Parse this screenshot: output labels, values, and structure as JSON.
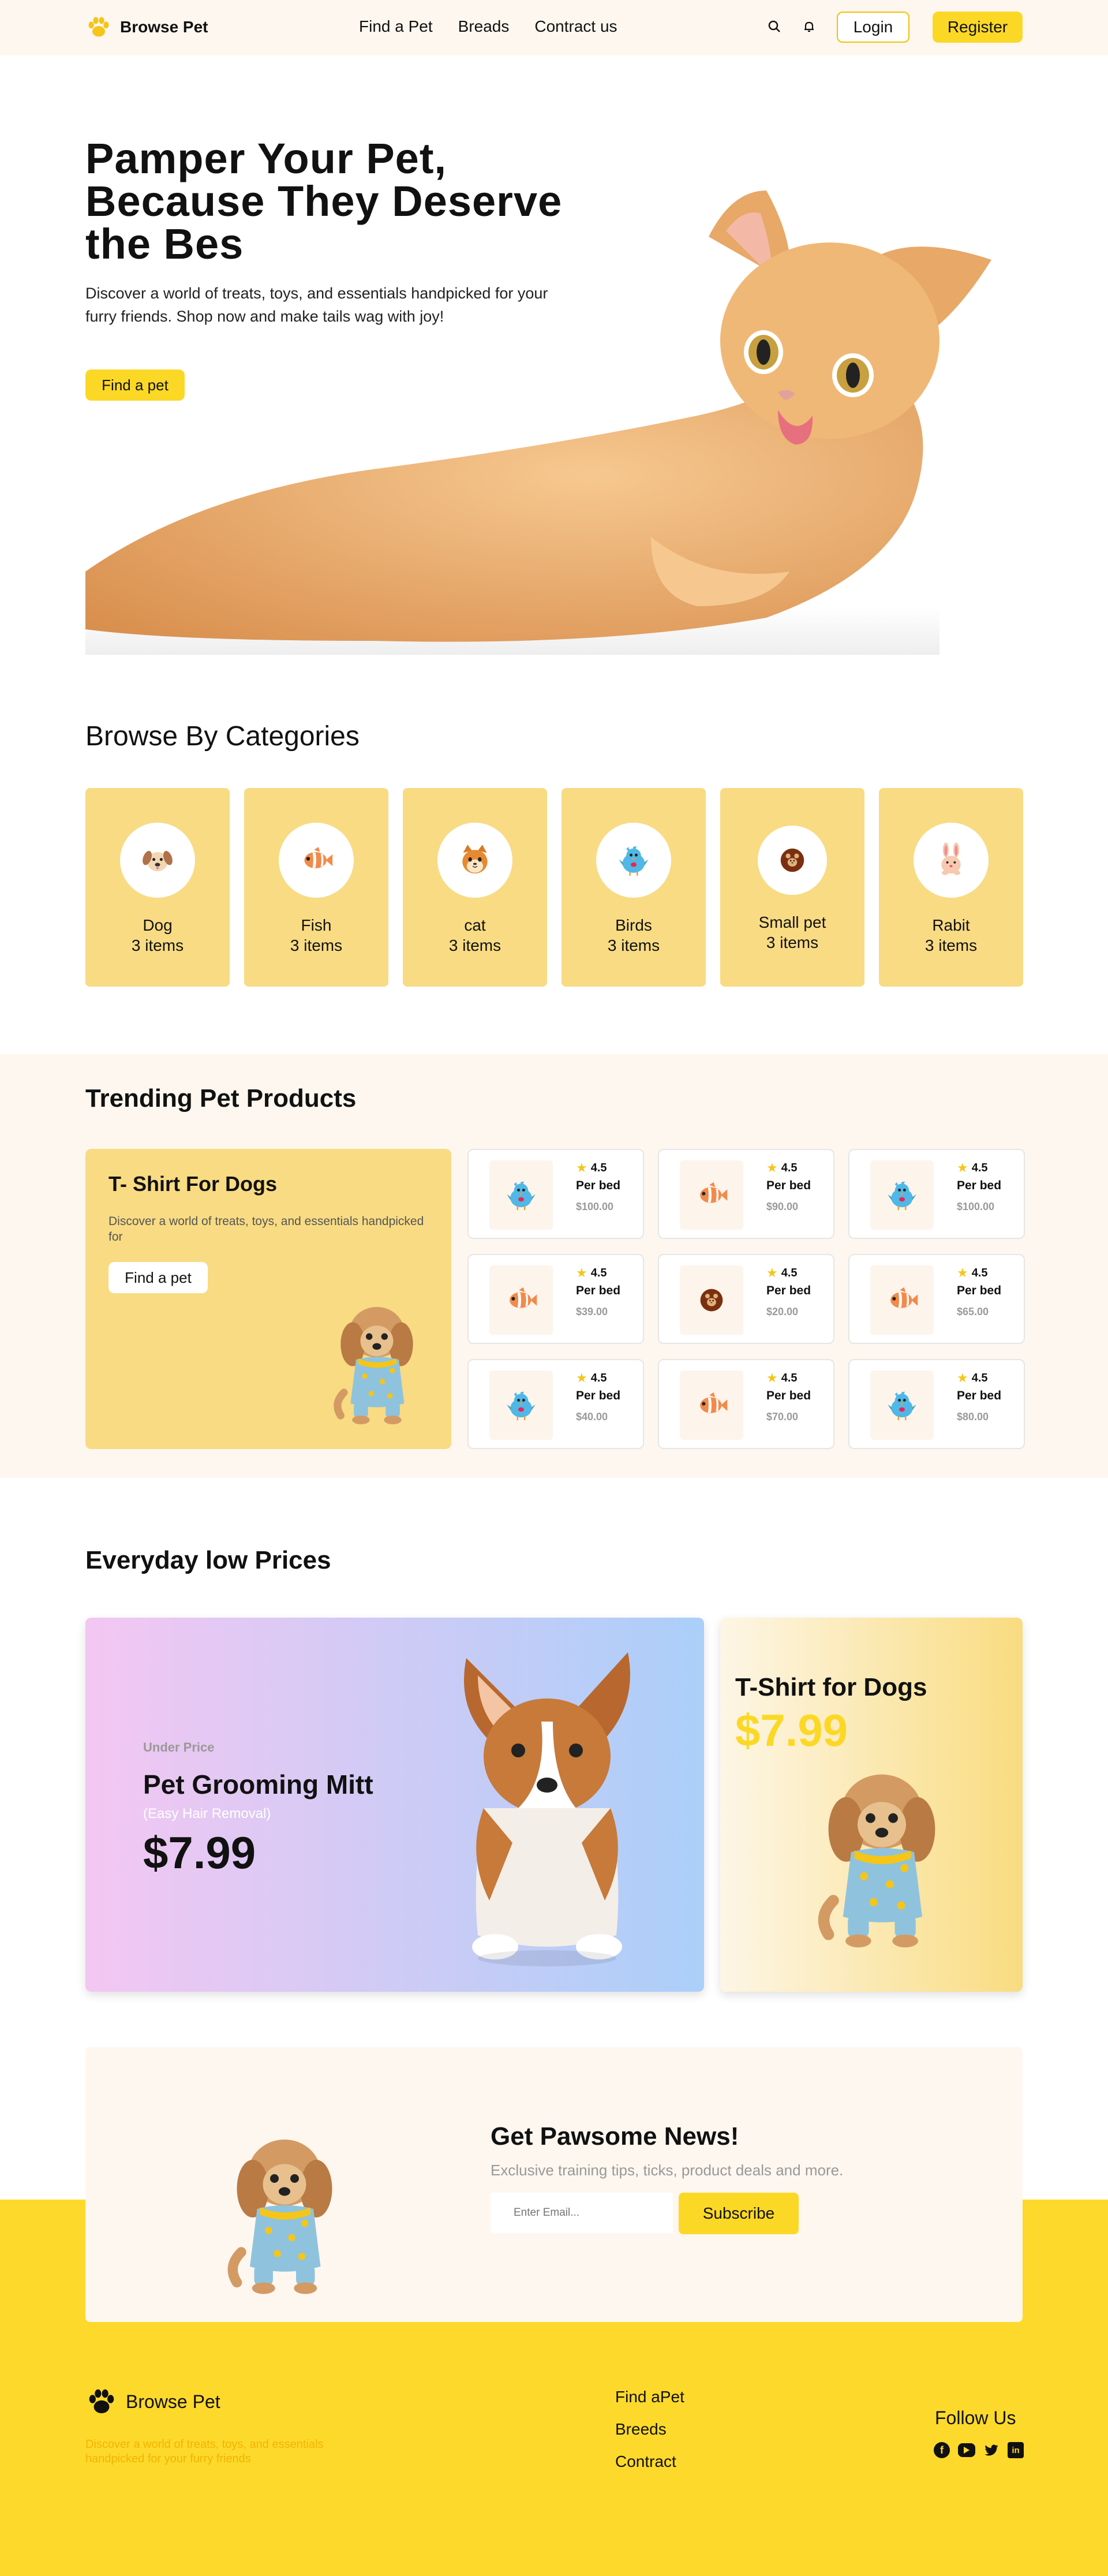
{
  "header": {
    "brand": "Browse Pet",
    "nav": [
      "Find a Pet",
      "Breads",
      "Contract us"
    ],
    "login": "Login",
    "register": "Register"
  },
  "hero": {
    "title_line1": "Pamper Your Pet,",
    "title_line2": "Because They Deserve",
    "title_line3": "the Bes",
    "description": "Discover a world of treats, toys, and essentials handpicked for your furry friends. Shop now and make tails wag with joy!",
    "cta": "Find a pet"
  },
  "categories": {
    "title": "Browse By Categories",
    "items": [
      {
        "name": "Dog",
        "count": "3 items",
        "icon": "dog-face-icon"
      },
      {
        "name": "Fish",
        "count": "3 items",
        "icon": "clownfish-icon"
      },
      {
        "name": "cat",
        "count": "3 items",
        "icon": "cat-face-icon"
      },
      {
        "name": "Birds",
        "count": "3 items",
        "icon": "bird-icon"
      },
      {
        "name": "Small pet",
        "count": "3 items",
        "icon": "hamster-icon"
      },
      {
        "name": "Rabit",
        "count": "3 items",
        "icon": "rabbit-icon"
      }
    ]
  },
  "trending": {
    "title": "Trending Pet Products",
    "feature": {
      "title": "T- Shirt For Dogs",
      "description": "Discover a world of treats, toys, and essentials handpicked for",
      "cta": "Find a pet"
    },
    "products": [
      {
        "rating": "4.5",
        "name": "Per bed",
        "price": "$100.00",
        "icon": "bird-icon"
      },
      {
        "rating": "4.5",
        "name": "Per bed",
        "price": "$90.00",
        "icon": "clownfish-icon"
      },
      {
        "rating": "4.5",
        "name": "Per bed",
        "price": "$100.00",
        "icon": "bird-icon"
      },
      {
        "rating": "4.5",
        "name": "Per bed",
        "price": "$39.00",
        "icon": "clownfish-icon"
      },
      {
        "rating": "4.5",
        "name": "Per bed",
        "price": "$20.00",
        "icon": "hamster-icon"
      },
      {
        "rating": "4.5",
        "name": "Per bed",
        "price": "$65.00",
        "icon": "clownfish-icon"
      },
      {
        "rating": "4.5",
        "name": "Per bed",
        "price": "$40.00",
        "icon": "bird-icon"
      },
      {
        "rating": "4.5",
        "name": "Per bed",
        "price": "$70.00",
        "icon": "clownfish-icon"
      },
      {
        "rating": "4.5",
        "name": "Per bed",
        "price": "$80.00",
        "icon": "bird-icon"
      }
    ]
  },
  "prices": {
    "title": "Everyday low Prices",
    "promo1": {
      "kicker": "Under Price",
      "title": "Pet Grooming Mitt",
      "subtitle": "(Easy Hair Removal)",
      "price": "$7.99"
    },
    "promo2": {
      "title": "T-Shirt for Dogs",
      "price": "$7.99"
    }
  },
  "newsletter": {
    "title": "Get Pawsome News!",
    "subtitle": "Exclusive training tips, ticks, product deals and more.",
    "placeholder": "Enter Email...",
    "button": "Subscribe"
  },
  "footer": {
    "brand": "Browse Pet",
    "description": "Discover a world of treats, toys, and essentials handpicked for your furry friends",
    "links": [
      "Find aPet",
      "Breeds",
      "Contract"
    ],
    "follow": "Follow Us",
    "socials": [
      "facebook-icon",
      "youtube-icon",
      "twitter-icon",
      "linkedin-icon"
    ]
  },
  "colors": {
    "accent": "#fcd826",
    "card": "#f8db83",
    "cream": "#fdf7ef"
  }
}
